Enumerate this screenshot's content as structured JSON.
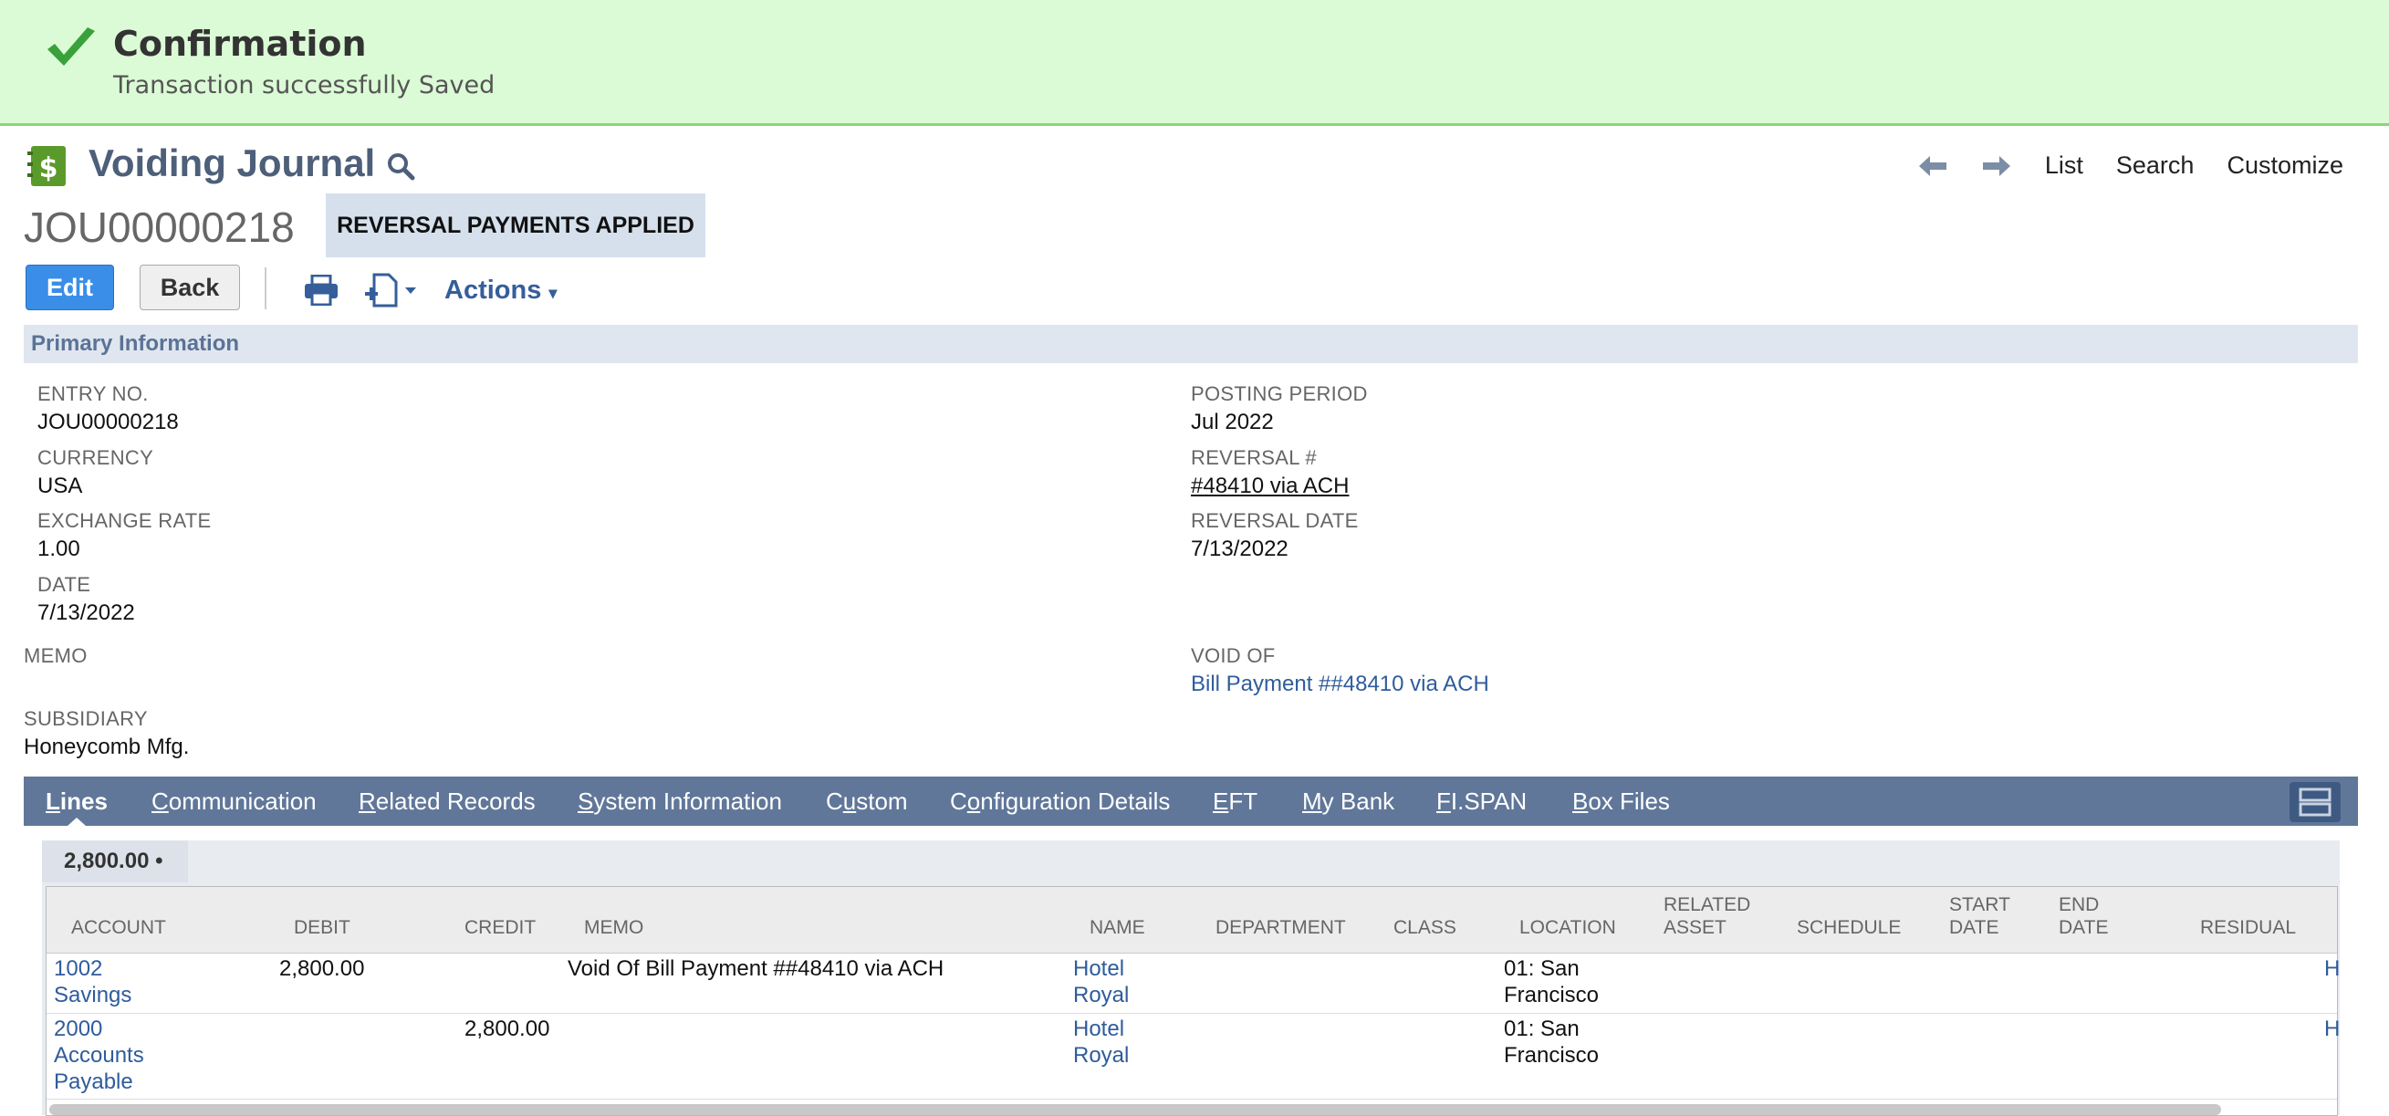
{
  "confirmation": {
    "title": "Confirmation",
    "message": "Transaction successfully Saved"
  },
  "header": {
    "title": "Voiding Journal",
    "record_id": "JOU00000218",
    "status": "REVERSAL PAYMENTS APPLIED",
    "nav": {
      "list": "List",
      "search": "Search",
      "customize": "Customize"
    }
  },
  "toolbar": {
    "edit": "Edit",
    "back": "Back",
    "actions": "Actions"
  },
  "primary": {
    "section_title": "Primary Information",
    "entry_no": {
      "label": "ENTRY NO.",
      "value": "JOU00000218"
    },
    "currency": {
      "label": "CURRENCY",
      "value": "USA"
    },
    "exchange_rate": {
      "label": "EXCHANGE RATE",
      "value": "1.00"
    },
    "date": {
      "label": "DATE",
      "value": "7/13/2022"
    },
    "memo": {
      "label": "MEMO",
      "value": ""
    },
    "subsidiary": {
      "label": "SUBSIDIARY",
      "value": "Honeycomb Mfg."
    },
    "posting_period": {
      "label": "POSTING PERIOD",
      "value": "Jul 2022"
    },
    "reversal_no": {
      "label": "REVERSAL #",
      "value": "#48410 via ACH"
    },
    "reversal_date": {
      "label": "REVERSAL DATE",
      "value": "7/13/2022"
    },
    "void_of": {
      "label": "VOID OF",
      "value": "Bill Payment ##48410 via ACH"
    }
  },
  "tabs": [
    {
      "key": "L",
      "rest": "ines"
    },
    {
      "key": "C",
      "rest": "ommunication"
    },
    {
      "key": "R",
      "rest": "elated Records"
    },
    {
      "key": "S",
      "rest": "ystem Information"
    },
    {
      "pre": "C",
      "key": "u",
      "rest": "stom"
    },
    {
      "pre": "C",
      "key": "o",
      "rest": "nfiguration Details"
    },
    {
      "key": "E",
      "rest": "FT"
    },
    {
      "key": "M",
      "rest": "y Bank"
    },
    {
      "key": "F",
      "rest": "I.SPAN"
    },
    {
      "key": "B",
      "rest": "ox Files"
    }
  ],
  "lines": {
    "total": "2,800.00 •",
    "columns": {
      "account": "ACCOUNT",
      "debit": "DEBIT",
      "credit": "CREDIT",
      "memo": "MEMO",
      "name": "NAME",
      "department": "DEPARTMENT",
      "class": "CLASS",
      "location": "LOCATION",
      "related_asset_1": "RELATED",
      "related_asset_2": "ASSET",
      "schedule": "SCHEDULE",
      "start_date_1": "START",
      "start_date_2": "DATE",
      "end_date_1": "END",
      "end_date_2": "DATE",
      "residual": "RESIDUAL"
    },
    "rows": [
      {
        "account_1": "1002",
        "account_2": "Savings",
        "account_3": "",
        "debit": "2,800.00",
        "credit": "",
        "memo": "Void Of Bill Payment ##48410 via ACH",
        "name_1": "Hotel",
        "name_2": "Royal",
        "location_1": "01: San",
        "location_2": "Francisco",
        "trunc": "H"
      },
      {
        "account_1": "2000",
        "account_2": "Accounts",
        "account_3": "Payable",
        "debit": "",
        "credit": "2,800.00",
        "memo": "",
        "name_1": "Hotel",
        "name_2": "Royal",
        "location_1": "01: San",
        "location_2": "Francisco",
        "trunc": "H"
      }
    ]
  },
  "colors": {
    "confirm_bg": "#dbfbd6",
    "accent": "#3a8ee8",
    "tab_bar": "#607799",
    "link": "#2f5c9c"
  }
}
